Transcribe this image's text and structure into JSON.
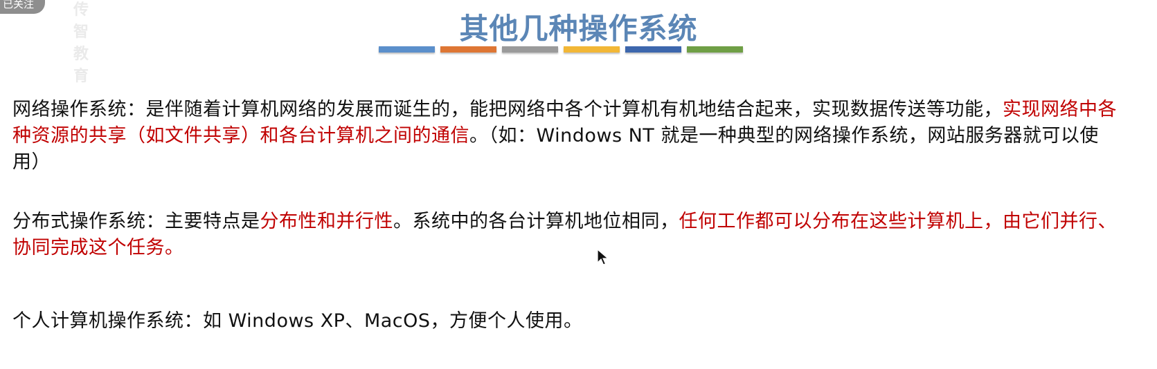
{
  "badge": {
    "label": "已关注",
    "watermark": "传智教育"
  },
  "title": "其他几种操作系统",
  "divider_colors": [
    "#5b8fcb",
    "#de7634",
    "#9a9a9a",
    "#f2b736",
    "#3d67ad",
    "#6f9f45"
  ],
  "accent_color": "#c00000",
  "network": {
    "prefix": "网络操作系统：是伴随着计算机网络的发展而诞生的，能把网络中各个计算机有机地结合起来，实现数据传送等功能，",
    "highlight": "实现网络中各种资源的共享（如文件共享）和各台计算机之间的通信",
    "suffix": "。（如：Windows NT 就是一种典型的网络操作系统，网站服务器就可以使用）"
  },
  "distributed": {
    "prefix": "分布式操作系统：主要特点是",
    "highlight1": "分布性和并行性",
    "middle": "。系统中的各台计算机地位相同，",
    "highlight2": "任何工作都可以分布在这些计算机上，由它们并行、协同完成这个任务。"
  },
  "personal": {
    "text": "个人计算机操作系统：如 Windows XP、MacOS，方便个人使用。"
  }
}
